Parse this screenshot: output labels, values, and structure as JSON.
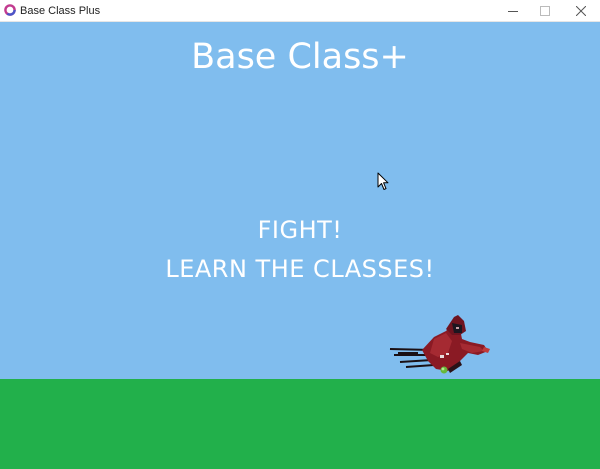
{
  "window": {
    "title": "Base Class Plus",
    "icon": "app-ring-icon",
    "controls": [
      "minimize-icon",
      "maximize-icon",
      "close-icon"
    ]
  },
  "game": {
    "title": "Base Class+",
    "tagline_1": "FIGHT!",
    "tagline_2": "LEARN THE CLASSES!"
  },
  "colors": {
    "sky": "#80bdee",
    "ground": "#22b04b",
    "text": "#ffffff",
    "character_robe": "#8a1a24"
  }
}
